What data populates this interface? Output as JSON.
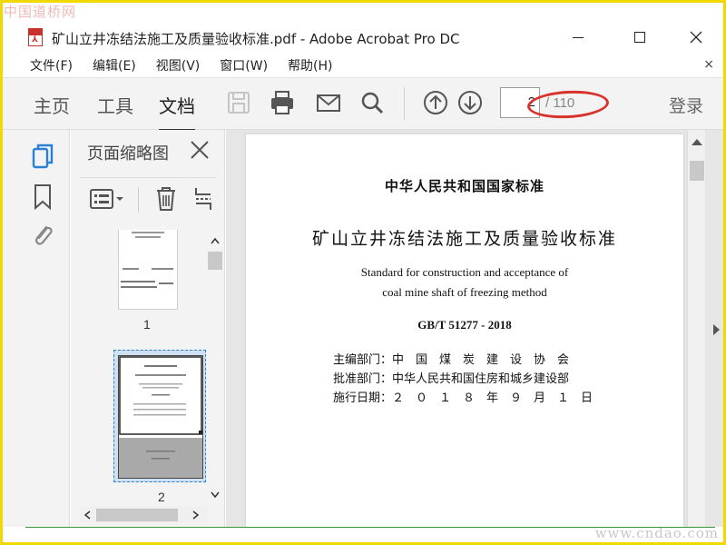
{
  "watermark": {
    "top_left": "中国道桥网",
    "bottom_right": "www.cndao.com"
  },
  "window": {
    "title": "矿山立井冻结法施工及质量验收标准.pdf - Adobe Acrobat Pro DC",
    "pdf_icon_glyph": "⅄"
  },
  "menu": {
    "items": [
      {
        "label": "文件(F)"
      },
      {
        "label": "编辑(E)"
      },
      {
        "label": "视图(V)"
      },
      {
        "label": "窗口(W)"
      },
      {
        "label": "帮助(H)"
      }
    ],
    "close_glyph": "×"
  },
  "toolbar": {
    "tabs": [
      {
        "label": "主页"
      },
      {
        "label": "工具"
      },
      {
        "label": "文档"
      }
    ],
    "active_tab": "文档",
    "current_page": "2",
    "total_pages": "/ 110",
    "login_label": "登录"
  },
  "sidebar": {
    "panel_title": "页面缩略图",
    "thumbnails": [
      {
        "label": "1"
      },
      {
        "label": "2"
      }
    ],
    "selected_thumbnail": "2"
  },
  "document": {
    "standard_org": "中华人民共和国国家标准",
    "title_cn": "矿山立井冻结法施工及质量验收标准",
    "title_en_line1": "Standard for construction and acceptance of",
    "title_en_line2": "coal mine shaft of freezing method",
    "code": "GB/T 51277 - 2018",
    "meta": [
      {
        "label": "主编部门：",
        "value": "中　国　煤　炭　建　设　协　会"
      },
      {
        "label": "批准部门：",
        "value": "中华人民共和国住房和城乡建设部"
      },
      {
        "label": "施行日期：",
        "value": "２　０　１　８　年　９　月　１　日"
      }
    ]
  },
  "colors": {
    "frame": "#f0d800",
    "accent_blue": "#2b7fd4",
    "annotation_red": "#d8322c",
    "selection": "#7fb2e0"
  }
}
